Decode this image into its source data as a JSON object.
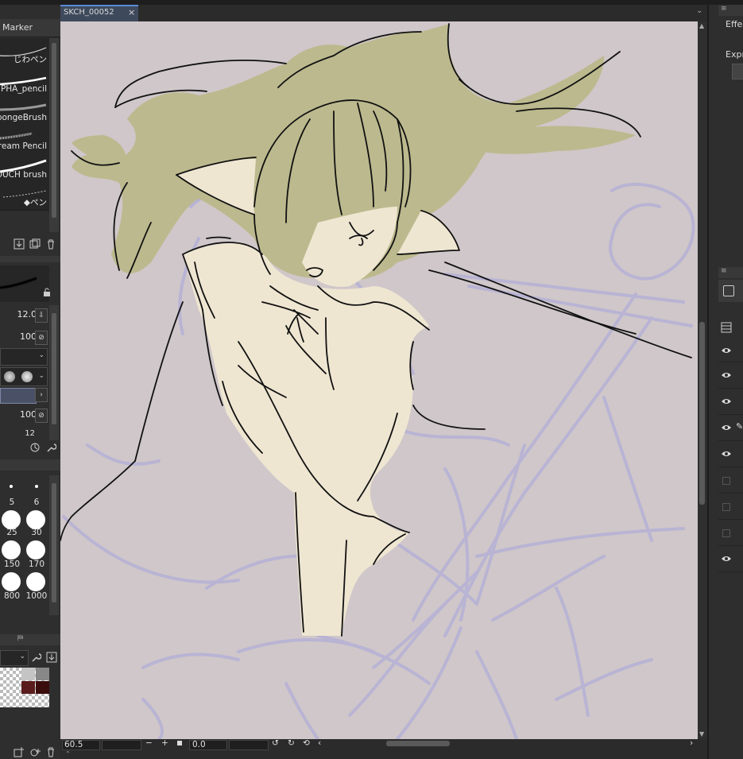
{
  "document": {
    "tab_label": "SKCH_00052",
    "close_symbol": "×"
  },
  "brush_panel": {
    "header": "Marker",
    "brushes": [
      {
        "label": "じわペン"
      },
      {
        "label": "PHA_pencil"
      },
      {
        "label": "pongeBrush"
      },
      {
        "label": "Cream Pencil"
      },
      {
        "label": "OUCH brush"
      },
      {
        "label": "◆ペン"
      }
    ]
  },
  "tool_property": {
    "brush_size": "12.0",
    "opacity": "100",
    "density": "100",
    "partial_value": "12"
  },
  "brush_size_palette": {
    "sizes": [
      "5",
      "6",
      "25",
      "30",
      "150",
      "170",
      "800",
      "1000"
    ]
  },
  "status_bar": {
    "zoom": "60.5",
    "rotation": "0.0",
    "minus_symbol": "−",
    "plus_symbol": "+"
  },
  "right_panel": {
    "effect_label": "Effe",
    "expression_label": "Expr"
  },
  "colors": {
    "canvas_bg": "#cfc7c9",
    "hair": "#bcb98e",
    "skin": "#efe6d2",
    "sketch": "#b9b4d4",
    "lineart": "#111111",
    "main_color_swatch": "#4a5166",
    "sub_color_dark_red": "#5a1c1c",
    "sub_color_darker_red": "#3a0c0c"
  }
}
